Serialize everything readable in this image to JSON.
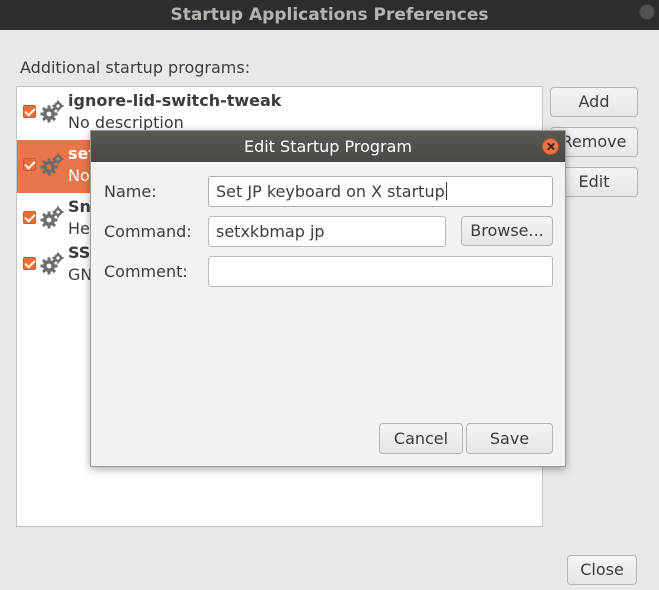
{
  "window": {
    "title": "Startup Applications Preferences"
  },
  "main": {
    "section_label": "Additional startup programs:",
    "programs": [
      {
        "name": "ignore-lid-switch-tweak",
        "description": "No description",
        "enabled": true,
        "selected": false
      },
      {
        "name": "set",
        "description": "No",
        "enabled": true,
        "selected": true
      },
      {
        "name": "Sna",
        "description": "He",
        "enabled": true,
        "selected": false
      },
      {
        "name": "SS",
        "description": "GN",
        "enabled": true,
        "selected": false
      }
    ],
    "buttons": {
      "add": "Add",
      "remove": "Remove",
      "edit": "Edit",
      "close": "Close"
    }
  },
  "dialog": {
    "title": "Edit Startup Program",
    "name_label": "Name:",
    "name_value": "Set JP keyboard on X startup",
    "command_label": "Command:",
    "command_value": "setxkbmap jp",
    "browse_label": "Browse...",
    "comment_label": "Comment:",
    "comment_value": "",
    "cancel_label": "Cancel",
    "save_label": "Save"
  },
  "colors": {
    "accent": "#e9764a",
    "titlebar": "#2e2d2b"
  },
  "icons": {
    "program": "gears-icon",
    "check": "checkbox-checked-icon"
  }
}
